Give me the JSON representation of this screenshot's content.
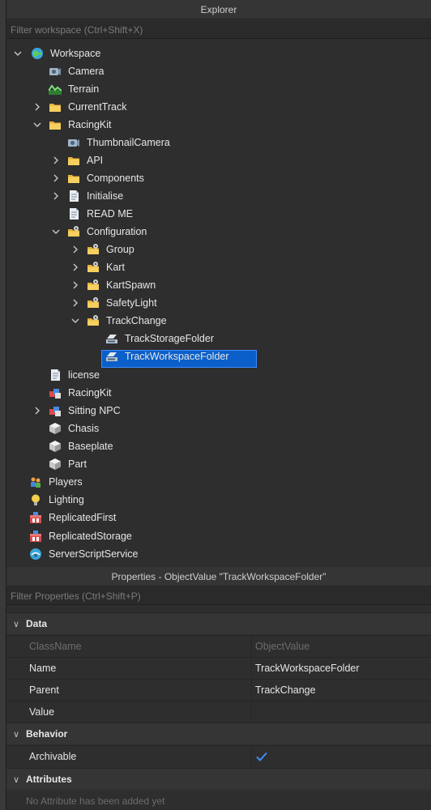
{
  "explorer": {
    "title": "Explorer",
    "filter_placeholder": "Filter workspace (Ctrl+Shift+X)",
    "items": [
      {
        "label": "Workspace",
        "icon": "workspace-globe-icon"
      },
      {
        "label": "Camera",
        "icon": "camera-icon"
      },
      {
        "label": "Terrain",
        "icon": "terrain-icon"
      },
      {
        "label": "CurrentTrack",
        "icon": "folder-icon"
      },
      {
        "label": "RacingKit",
        "icon": "folder-icon"
      },
      {
        "label": "ThumbnailCamera",
        "icon": "camera-icon"
      },
      {
        "label": "API",
        "icon": "folder-icon"
      },
      {
        "label": "Components",
        "icon": "folder-icon"
      },
      {
        "label": "Initialise",
        "icon": "script-icon"
      },
      {
        "label": "READ ME",
        "icon": "script-icon"
      },
      {
        "label": "Configuration",
        "icon": "config-folder-icon"
      },
      {
        "label": "Group",
        "icon": "config-folder-icon"
      },
      {
        "label": "Kart",
        "icon": "config-folder-icon"
      },
      {
        "label": "KartSpawn",
        "icon": "config-folder-icon"
      },
      {
        "label": "SafetyLight",
        "icon": "config-folder-icon"
      },
      {
        "label": "TrackChange",
        "icon": "config-folder-icon"
      },
      {
        "label": "TrackStorageFolder",
        "icon": "objectvalue-icon"
      },
      {
        "label": "TrackWorkspaceFolder",
        "icon": "objectvalue-icon"
      },
      {
        "label": "license",
        "icon": "script-icon"
      },
      {
        "label": "RacingKit",
        "icon": "model-icon"
      },
      {
        "label": "Sitting NPC",
        "icon": "model-icon"
      },
      {
        "label": "Chasis",
        "icon": "part-icon"
      },
      {
        "label": "Baseplate",
        "icon": "part-icon"
      },
      {
        "label": "Part",
        "icon": "part-icon"
      },
      {
        "label": "Players",
        "icon": "players-icon"
      },
      {
        "label": "Lighting",
        "icon": "lighting-icon"
      },
      {
        "label": "ReplicatedFirst",
        "icon": "replicated-icon"
      },
      {
        "label": "ReplicatedStorage",
        "icon": "replicated-icon"
      },
      {
        "label": "ServerScriptService",
        "icon": "server-script-icon"
      }
    ]
  },
  "properties": {
    "title": "Properties - ObjectValue \"TrackWorkspaceFolder\"",
    "filter_placeholder": "Filter Properties (Ctrl+Shift+P)",
    "sections": {
      "data": "Data",
      "behavior": "Behavior",
      "attributes": "Attributes"
    },
    "rows": {
      "classname": {
        "name": "ClassName",
        "value": "ObjectValue"
      },
      "name": {
        "name": "Name",
        "value": "TrackWorkspaceFolder"
      },
      "parent": {
        "name": "Parent",
        "value": "TrackChange"
      },
      "value": {
        "name": "Value",
        "value": ""
      },
      "archivable": {
        "name": "Archivable",
        "checked": true
      }
    },
    "attributes_empty": "No Attribute has been added yet"
  },
  "colors": {
    "selection": "#0b5fc8",
    "folder": "#f3c84d",
    "checkmark": "#3d8bff"
  }
}
